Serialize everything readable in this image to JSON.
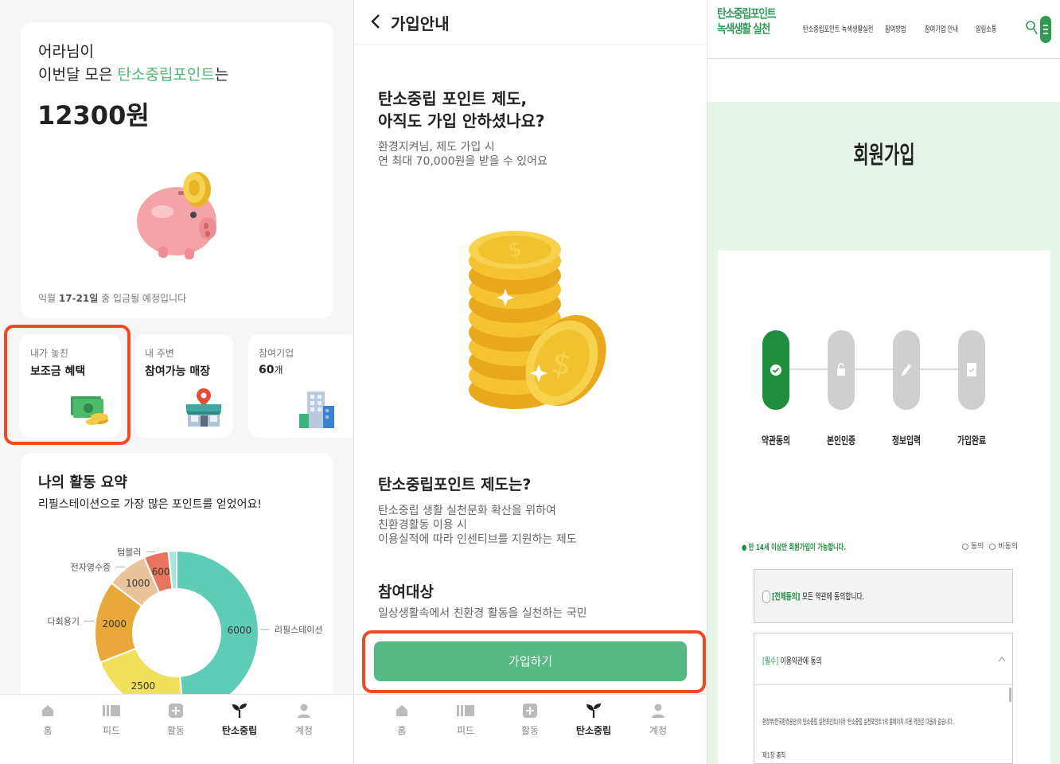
{
  "panel1": {
    "greeting_name": "어라님이",
    "greeting_line_prefix": "이번달 모은 ",
    "greeting_highlight": "탄소중립포인트",
    "greeting_line_suffix": "는",
    "amount": "12300원",
    "deposit_prefix": "익월 ",
    "deposit_dates": "17-21일",
    "deposit_suffix": " 중 입금될 예정입니다",
    "tiles": [
      {
        "sub": "내가 놓친",
        "title": "보조금 혜택"
      },
      {
        "sub": "내 주변",
        "title": "참여가능 매장"
      },
      {
        "sub": "참여기업",
        "count": "60",
        "unit": "개"
      }
    ],
    "summary_title": "나의 활동 요약",
    "summary_desc": "리필스테이션으로 가장 많은 포인트를 얻었어요!",
    "chart_data": {
      "type": "pie",
      "series": [
        {
          "label": "리필스테이션",
          "value": 6000,
          "color": "#5fcdb6"
        },
        {
          "label": "",
          "value": 2500,
          "color": "#f0e05a"
        },
        {
          "label": "다회용기",
          "value": 2000,
          "color": "#e8a83a"
        },
        {
          "label": "전자영수증",
          "value": 1000,
          "color": "#e9c39c"
        },
        {
          "label": "텀블러",
          "value": 600,
          "color": "#e8735e"
        },
        {
          "label": "",
          "value": 200,
          "color": "#a8e6dc"
        }
      ]
    }
  },
  "nav": [
    {
      "label": "홈",
      "icon": "home-icon"
    },
    {
      "label": "피드",
      "icon": "feed-icon"
    },
    {
      "label": "활동",
      "icon": "plus-square-icon"
    },
    {
      "label": "탄소중립",
      "icon": "sprout-icon",
      "active": true
    },
    {
      "label": "계정",
      "icon": "person-icon"
    }
  ],
  "panel2": {
    "header_title": "가입안내",
    "headline_1": "탄소중립 포인트 제도,",
    "headline_2": "아직도 가입 안하셨나요?",
    "sub_1": "환경지켜님, 제도 가입 시",
    "sub_2": "연 최대 70,000원을 받을 수 있어요",
    "section1_title": "탄소중립포인트 제도는?",
    "section1_lines": [
      "탄소중립 생활 실천문화 확산을 위하여",
      "친환경활동 이용 시",
      "이용실적에 따라 인센티브를 지원하는 제도"
    ],
    "section2_title": "참여대상",
    "section2_desc": "일상생활속에서 친환경 활동을 실천하는 국민",
    "join_button": "가입하기"
  },
  "panel3": {
    "logo_line1": "탄소중립포인트",
    "logo_line2": "녹색생활 실천",
    "menu": [
      "탄소중립포인트 녹색생활실천",
      "참여방법",
      "참여기업 안내",
      "알림소통"
    ],
    "page_title": "회원가입",
    "steps": [
      "약관동의",
      "본인인증",
      "정보입력",
      "가입완료"
    ],
    "age_notice": "● 만 14세 이상만 회원가입이 가능합니다.",
    "agree": "동의",
    "disagree": "비동의",
    "all_agree_tag": "[전체동의]",
    "all_agree_text": "모든 약관에 동의합니다.",
    "terms_tag": "[필수]",
    "terms_text": "이용약관에 동의",
    "terms_body": "환경부(한국환경공단)의 탄소중립 실천포인트(이하 '탄소중립 실천포인트')의 홈페이지 이용 약관은 다음과 같습니다.",
    "terms_chapter": "제1장 총칙"
  }
}
